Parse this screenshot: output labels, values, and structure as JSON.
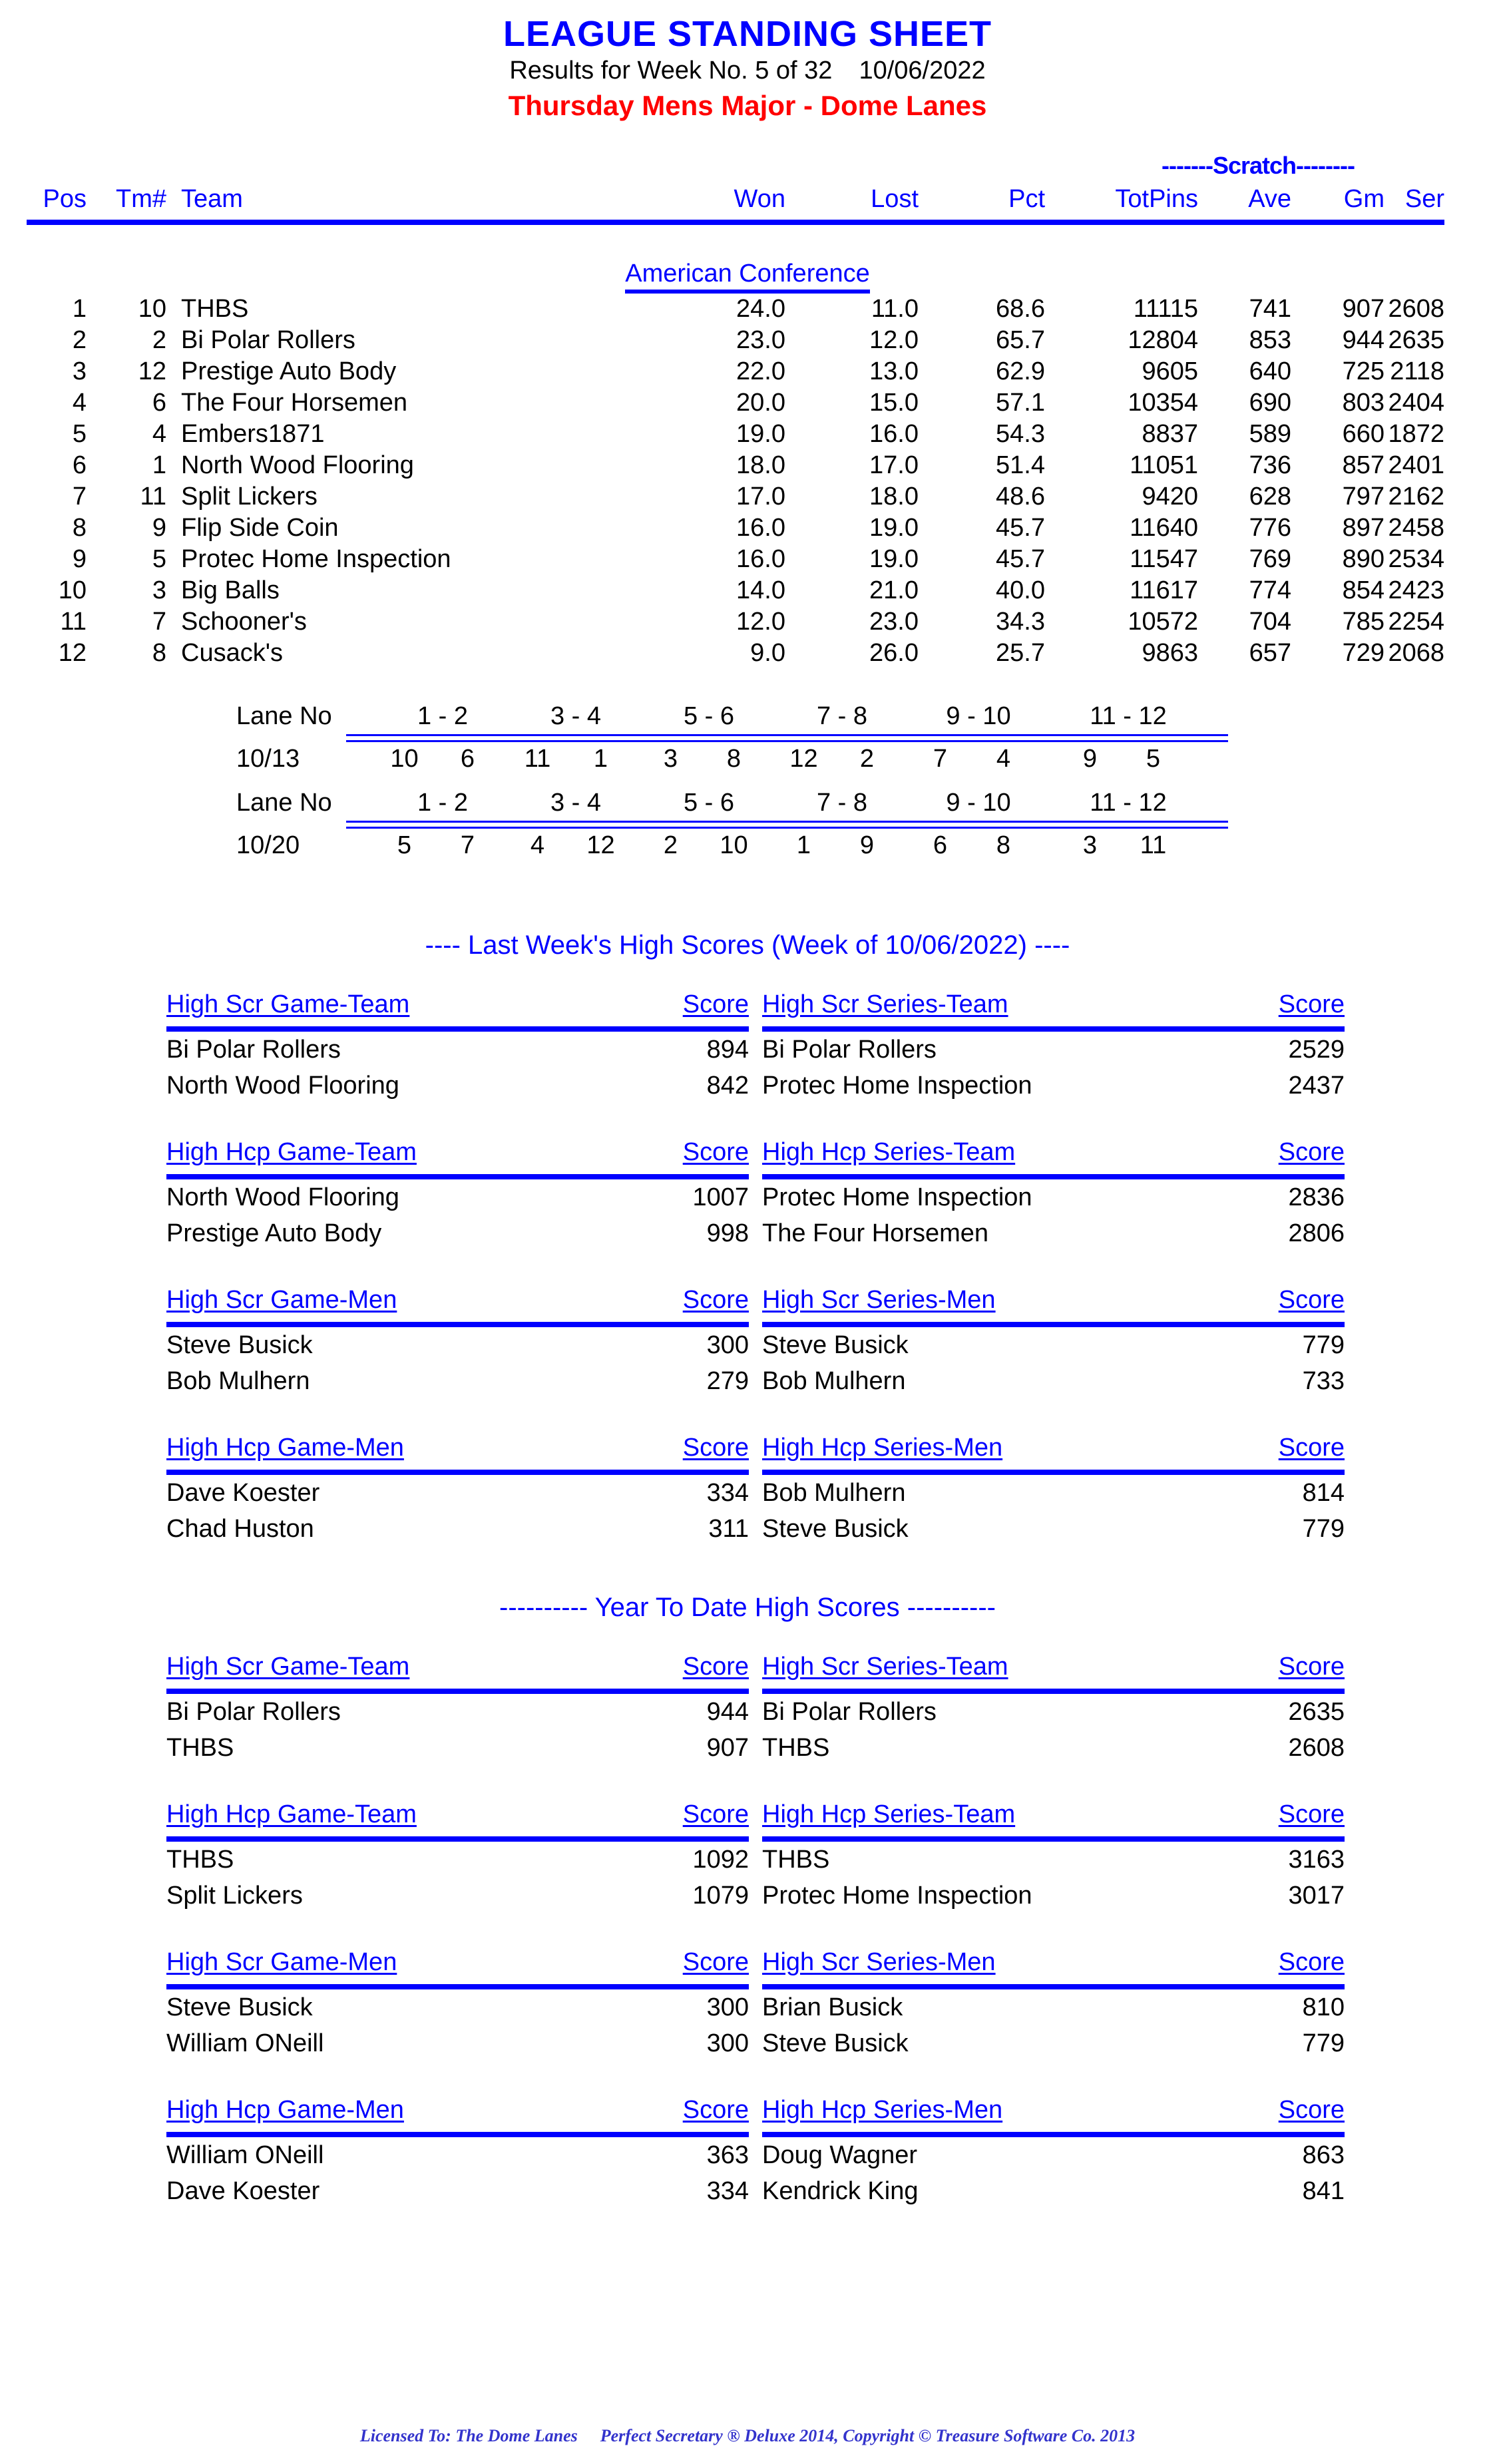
{
  "header": {
    "title": "LEAGUE STANDING SHEET",
    "results_prefix": "Results for Week No. 5 of 32",
    "results_date": "10/06/2022",
    "league": "Thursday Mens Major - Dome Lanes"
  },
  "standings": {
    "scratch_label": "-------Scratch--------",
    "columns": {
      "pos": "Pos",
      "tm": "Tm#",
      "team": "Team",
      "won": "Won",
      "lost": "Lost",
      "pct": "Pct",
      "totpins": "TotPins",
      "ave": "Ave",
      "gm": "Gm",
      "ser": "Ser"
    },
    "conference": "American Conference",
    "rows": [
      {
        "pos": "1",
        "tm": "10",
        "team": "THBS",
        "won": "24.0",
        "lost": "11.0",
        "pct": "68.6",
        "totpins": "11115",
        "ave": "741",
        "gm": "907",
        "ser": "2608"
      },
      {
        "pos": "2",
        "tm": "2",
        "team": "Bi Polar Rollers",
        "won": "23.0",
        "lost": "12.0",
        "pct": "65.7",
        "totpins": "12804",
        "ave": "853",
        "gm": "944",
        "ser": "2635"
      },
      {
        "pos": "3",
        "tm": "12",
        "team": "Prestige Auto Body",
        "won": "22.0",
        "lost": "13.0",
        "pct": "62.9",
        "totpins": "9605",
        "ave": "640",
        "gm": "725",
        "ser": "2118"
      },
      {
        "pos": "4",
        "tm": "6",
        "team": "The Four Horsemen",
        "won": "20.0",
        "lost": "15.0",
        "pct": "57.1",
        "totpins": "10354",
        "ave": "690",
        "gm": "803",
        "ser": "2404"
      },
      {
        "pos": "5",
        "tm": "4",
        "team": "Embers1871",
        "won": "19.0",
        "lost": "16.0",
        "pct": "54.3",
        "totpins": "8837",
        "ave": "589",
        "gm": "660",
        "ser": "1872"
      },
      {
        "pos": "6",
        "tm": "1",
        "team": "North Wood Flooring",
        "won": "18.0",
        "lost": "17.0",
        "pct": "51.4",
        "totpins": "11051",
        "ave": "736",
        "gm": "857",
        "ser": "2401"
      },
      {
        "pos": "7",
        "tm": "11",
        "team": "Split Lickers",
        "won": "17.0",
        "lost": "18.0",
        "pct": "48.6",
        "totpins": "9420",
        "ave": "628",
        "gm": "797",
        "ser": "2162"
      },
      {
        "pos": "8",
        "tm": "9",
        "team": "Flip Side Coin",
        "won": "16.0",
        "lost": "19.0",
        "pct": "45.7",
        "totpins": "11640",
        "ave": "776",
        "gm": "897",
        "ser": "2458"
      },
      {
        "pos": "9",
        "tm": "5",
        "team": "Protec Home Inspection",
        "won": "16.0",
        "lost": "19.0",
        "pct": "45.7",
        "totpins": "11547",
        "ave": "769",
        "gm": "890",
        "ser": "2534"
      },
      {
        "pos": "10",
        "tm": "3",
        "team": "Big Balls",
        "won": "14.0",
        "lost": "21.0",
        "pct": "40.0",
        "totpins": "11617",
        "ave": "774",
        "gm": "854",
        "ser": "2423"
      },
      {
        "pos": "11",
        "tm": "7",
        "team": "Schooner's",
        "won": "12.0",
        "lost": "23.0",
        "pct": "34.3",
        "totpins": "10572",
        "ave": "704",
        "gm": "785",
        "ser": "2254"
      },
      {
        "pos": "12",
        "tm": "8",
        "team": "Cusack's",
        "won": "9.0",
        "lost": "26.0",
        "pct": "25.7",
        "totpins": "9863",
        "ave": "657",
        "gm": "729",
        "ser": "2068"
      }
    ]
  },
  "lane_schedules": [
    {
      "header_label": "Lane No",
      "date_label": "10/13",
      "lanes": [
        "1 - 2",
        "3 - 4",
        "5 - 6",
        "7 - 8",
        "9 - 10",
        "11 - 12"
      ],
      "matchups": [
        [
          "10",
          "6"
        ],
        [
          "11",
          "1"
        ],
        [
          "3",
          "8"
        ],
        [
          "12",
          "2"
        ],
        [
          "7",
          "4"
        ],
        [
          "9",
          "5"
        ]
      ]
    },
    {
      "header_label": "Lane No",
      "date_label": "10/20",
      "lanes": [
        "1 - 2",
        "3 - 4",
        "5 - 6",
        "7 - 8",
        "9 - 10",
        "11 - 12"
      ],
      "matchups": [
        [
          "5",
          "7"
        ],
        [
          "4",
          "12"
        ],
        [
          "2",
          "10"
        ],
        [
          "1",
          "9"
        ],
        [
          "6",
          "8"
        ],
        [
          "3",
          "11"
        ]
      ]
    }
  ],
  "last_week": {
    "banner": "----  Last Week's High Scores   (Week of 10/06/2022)  ----",
    "score_header": "Score",
    "groups": [
      {
        "left": {
          "title": "High Scr Game-Team",
          "rows": [
            {
              "name": "Bi Polar Rollers",
              "score": "894"
            },
            {
              "name": "North Wood Flooring",
              "score": "842"
            }
          ]
        },
        "right": {
          "title": "High Scr Series-Team",
          "rows": [
            {
              "name": "Bi Polar Rollers",
              "score": "2529"
            },
            {
              "name": "Protec Home Inspection",
              "score": "2437"
            }
          ]
        }
      },
      {
        "left": {
          "title": "High Hcp Game-Team",
          "rows": [
            {
              "name": "North Wood Flooring",
              "score": "1007"
            },
            {
              "name": "Prestige Auto Body",
              "score": "998"
            }
          ]
        },
        "right": {
          "title": "High Hcp Series-Team",
          "rows": [
            {
              "name": "Protec Home Inspection",
              "score": "2836"
            },
            {
              "name": "The Four Horsemen",
              "score": "2806"
            }
          ]
        }
      },
      {
        "left": {
          "title": "High Scr Game-Men",
          "rows": [
            {
              "name": "Steve Busick",
              "score": "300"
            },
            {
              "name": "Bob Mulhern",
              "score": "279"
            }
          ]
        },
        "right": {
          "title": "High Scr Series-Men",
          "rows": [
            {
              "name": "Steve Busick",
              "score": "779"
            },
            {
              "name": "Bob Mulhern",
              "score": "733"
            }
          ]
        }
      },
      {
        "left": {
          "title": "High Hcp Game-Men",
          "rows": [
            {
              "name": "Dave Koester",
              "score": "334"
            },
            {
              "name": "Chad Huston",
              "score": "311"
            }
          ]
        },
        "right": {
          "title": "High Hcp Series-Men",
          "rows": [
            {
              "name": "Bob Mulhern",
              "score": "814"
            },
            {
              "name": "Steve Busick",
              "score": "779"
            }
          ]
        }
      }
    ]
  },
  "year_to_date": {
    "banner": "---------- Year To Date High Scores ----------",
    "score_header": "Score",
    "groups": [
      {
        "left": {
          "title": "High Scr Game-Team",
          "rows": [
            {
              "name": "Bi Polar Rollers",
              "score": "944"
            },
            {
              "name": "THBS",
              "score": "907"
            }
          ]
        },
        "right": {
          "title": "High Scr Series-Team",
          "rows": [
            {
              "name": "Bi Polar Rollers",
              "score": "2635"
            },
            {
              "name": "THBS",
              "score": "2608"
            }
          ]
        }
      },
      {
        "left": {
          "title": "High Hcp Game-Team",
          "rows": [
            {
              "name": "THBS",
              "score": "1092"
            },
            {
              "name": "Split Lickers",
              "score": "1079"
            }
          ]
        },
        "right": {
          "title": "High Hcp Series-Team",
          "rows": [
            {
              "name": "THBS",
              "score": "3163"
            },
            {
              "name": "Protec Home Inspection",
              "score": "3017"
            }
          ]
        }
      },
      {
        "left": {
          "title": "High Scr Game-Men",
          "rows": [
            {
              "name": "Steve Busick",
              "score": "300"
            },
            {
              "name": "William ONeill",
              "score": "300"
            }
          ]
        },
        "right": {
          "title": "High Scr Series-Men",
          "rows": [
            {
              "name": "Brian Busick",
              "score": "810"
            },
            {
              "name": "Steve Busick",
              "score": "779"
            }
          ]
        }
      },
      {
        "left": {
          "title": "High Hcp Game-Men",
          "rows": [
            {
              "name": "William ONeill",
              "score": "363"
            },
            {
              "name": "Dave Koester",
              "score": "334"
            }
          ]
        },
        "right": {
          "title": "High Hcp Series-Men",
          "rows": [
            {
              "name": "Doug Wagner",
              "score": "863"
            },
            {
              "name": "Kendrick King",
              "score": "841"
            }
          ]
        }
      }
    ]
  },
  "footer": {
    "licensed_to": "Licensed To: The Dome Lanes",
    "copyright": "Perfect Secretary ® Deluxe  2014, Copyright © Treasure Software Co. 2013"
  },
  "colors": {
    "accent_blue": "#0000ff",
    "league_red": "#ff0000",
    "footer_blue": "#3333cc"
  }
}
